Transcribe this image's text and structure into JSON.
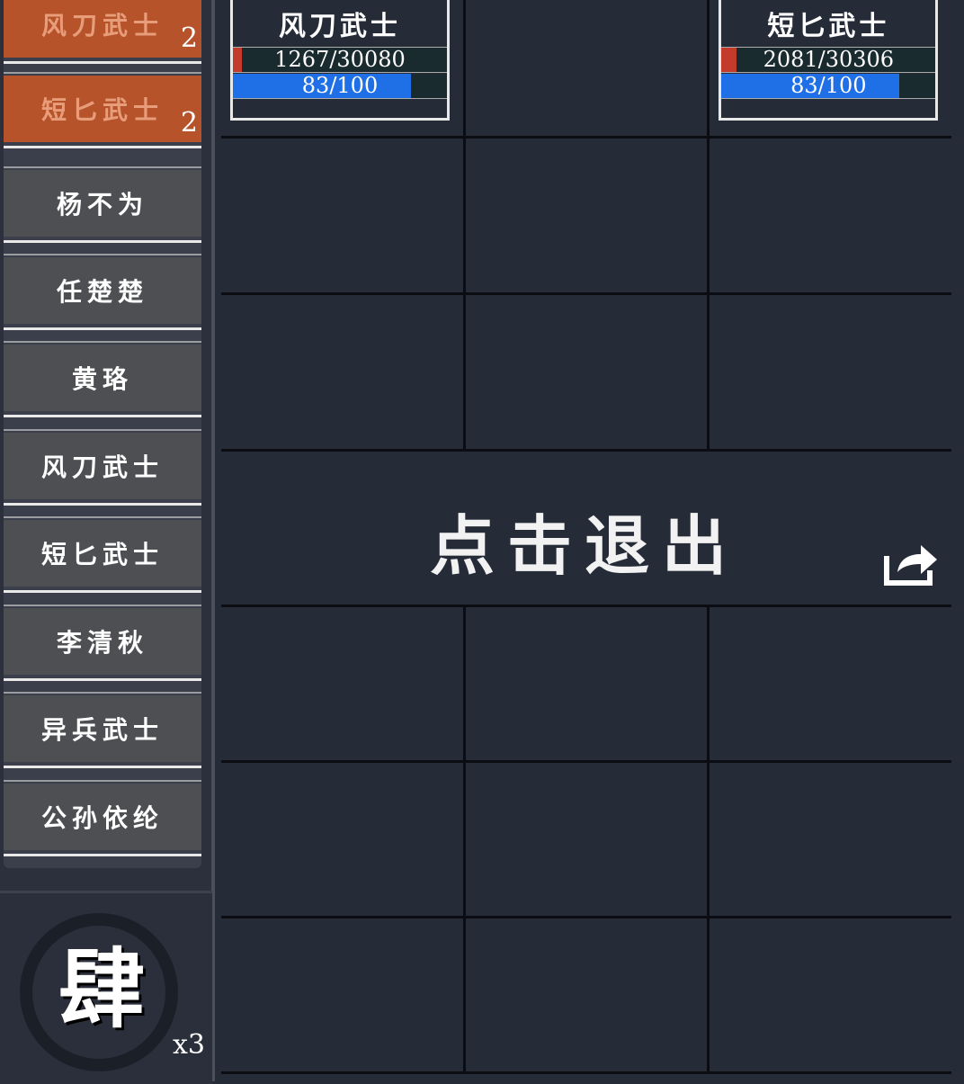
{
  "sidebar": {
    "items": [
      {
        "label": "风刀武士",
        "count": "2",
        "active": true
      },
      {
        "label": "短匕武士",
        "count": "2",
        "active": true
      },
      {
        "label": "杨不为",
        "count": "",
        "active": false
      },
      {
        "label": "任楚楚",
        "count": "",
        "active": false
      },
      {
        "label": "黄珞",
        "count": "",
        "active": false
      },
      {
        "label": "风刀武士",
        "count": "",
        "active": false
      },
      {
        "label": "短匕武士",
        "count": "",
        "active": false
      },
      {
        "label": "李清秋",
        "count": "",
        "active": false
      },
      {
        "label": "异兵武士",
        "count": "",
        "active": false
      },
      {
        "label": "公孙依纶",
        "count": "",
        "active": false
      }
    ]
  },
  "skill": {
    "glyph": "肆",
    "count": "x3"
  },
  "units": [
    {
      "name": "风刀武士",
      "hp_text": "1267/30080",
      "hp_ratio": 0.042,
      "mp_text": "83/100",
      "mp_ratio": 0.83
    },
    {
      "name": "短匕武士",
      "hp_text": "2081/30306",
      "hp_ratio": 0.069,
      "mp_text": "83/100",
      "mp_ratio": 0.83
    }
  ],
  "center": {
    "exit_label": "点击退出"
  },
  "icons": {
    "share": "share-icon",
    "skill_ring": "ink-circle-icon"
  },
  "colors": {
    "active_item": "#b6532b",
    "hp": "#c33b2a",
    "mp": "#1f6fe6",
    "background": "#262b38"
  }
}
